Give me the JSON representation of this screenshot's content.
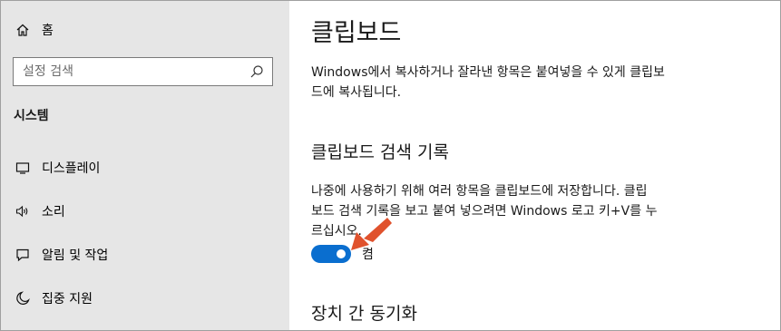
{
  "sidebar": {
    "home_label": "홈",
    "search_placeholder": "설정 검색",
    "section_title": "시스템",
    "items": [
      {
        "label": "디스플레이",
        "icon": "monitor-icon"
      },
      {
        "label": "소리",
        "icon": "speaker-icon"
      },
      {
        "label": "알림 및 작업",
        "icon": "notification-icon"
      },
      {
        "label": "집중 지원",
        "icon": "moon-icon"
      }
    ]
  },
  "main": {
    "title": "클립보드",
    "description_lines": [
      "Windows에서 복사하거나 잘라낸 항목은 붙여넣을 수 있게 클립보",
      "드에 복사됩니다."
    ],
    "history": {
      "heading": "클립보드 검색 기록",
      "description_lines": [
        "나중에 사용하기 위해 여러 항목을 클립보드에 저장합니다. 클립",
        "보드 검색 기록을 보고 붙여 넣으려면 Windows 로고 키+V를 누",
        "르십시오."
      ],
      "toggle_label": "켬",
      "toggle_on": true
    },
    "sync_heading": "장치 간 동기화"
  },
  "colors": {
    "sidebar_bg": "#e6e6e6",
    "accent": "#0a6ecf",
    "annotation_arrow": "#e0522d"
  }
}
